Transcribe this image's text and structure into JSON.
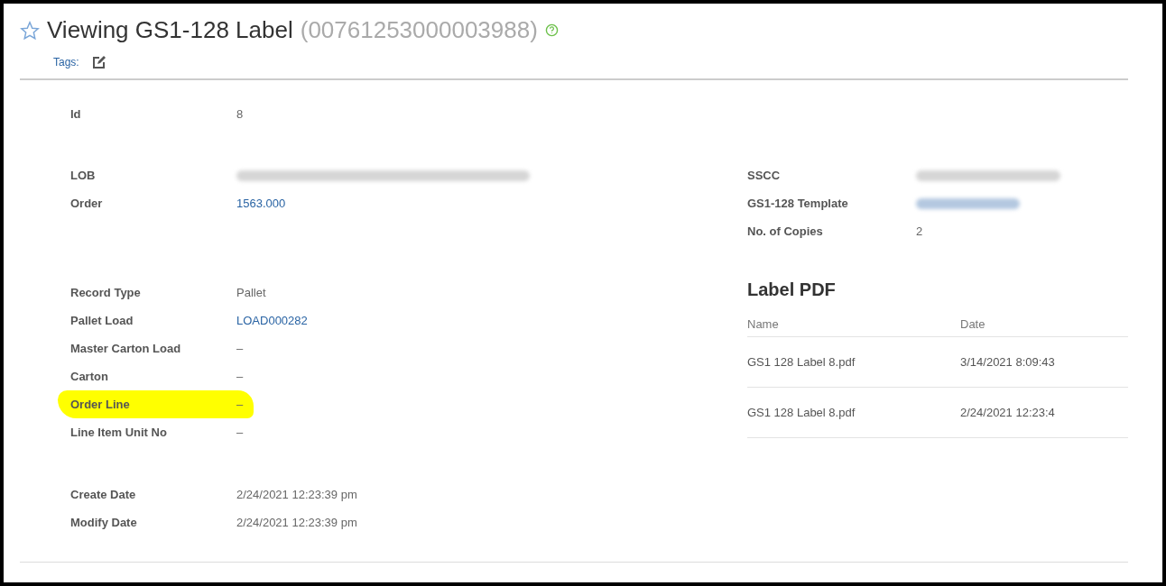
{
  "header": {
    "title": "Viewing GS1-128 Label",
    "identifier": "(00761253000003988)",
    "favorite": false,
    "tags_label": "Tags:"
  },
  "left_groups": [
    [
      {
        "label": "Id",
        "value": "8",
        "kind": "text",
        "highlighted": false
      }
    ],
    [
      {
        "label": "LOB",
        "kind": "redacted",
        "highlighted": false
      },
      {
        "label": "Order",
        "value": "1563.000",
        "kind": "link",
        "highlighted": false
      }
    ],
    [
      {
        "label": "Record Type",
        "value": "Pallet",
        "kind": "text",
        "highlighted": false
      },
      {
        "label": "Pallet Load",
        "value": "LOAD000282",
        "kind": "link",
        "highlighted": false
      },
      {
        "label": "Master Carton Load",
        "value": "–",
        "kind": "text",
        "highlighted": false
      },
      {
        "label": "Carton",
        "value": "–",
        "kind": "text",
        "highlighted": false
      },
      {
        "label": "Order Line",
        "value": "–",
        "kind": "text",
        "highlighted": true
      },
      {
        "label": "Line Item Unit No",
        "value": "–",
        "kind": "text",
        "highlighted": false
      }
    ],
    [
      {
        "label": "Create Date",
        "value": "2/24/2021  12:23:39 pm",
        "kind": "text",
        "highlighted": false
      },
      {
        "label": "Modify Date",
        "value": "2/24/2021  12:23:39 pm",
        "kind": "text",
        "highlighted": false
      }
    ]
  ],
  "right_fields": [
    {
      "label": "SSCC",
      "kind": "redacted"
    },
    {
      "label": "GS1-128 Template",
      "kind": "redacted_link"
    },
    {
      "label": "No. of Copies",
      "value": "2",
      "kind": "text"
    }
  ],
  "label_pdf": {
    "title": "Label PDF",
    "columns": [
      "Name",
      "Date"
    ],
    "rows": [
      {
        "name": "GS1 128 Label 8.pdf",
        "date": "3/14/2021  8:09:43"
      },
      {
        "name": "GS1 128 Label 8.pdf",
        "date": "2/24/2021  12:23:4"
      }
    ]
  }
}
